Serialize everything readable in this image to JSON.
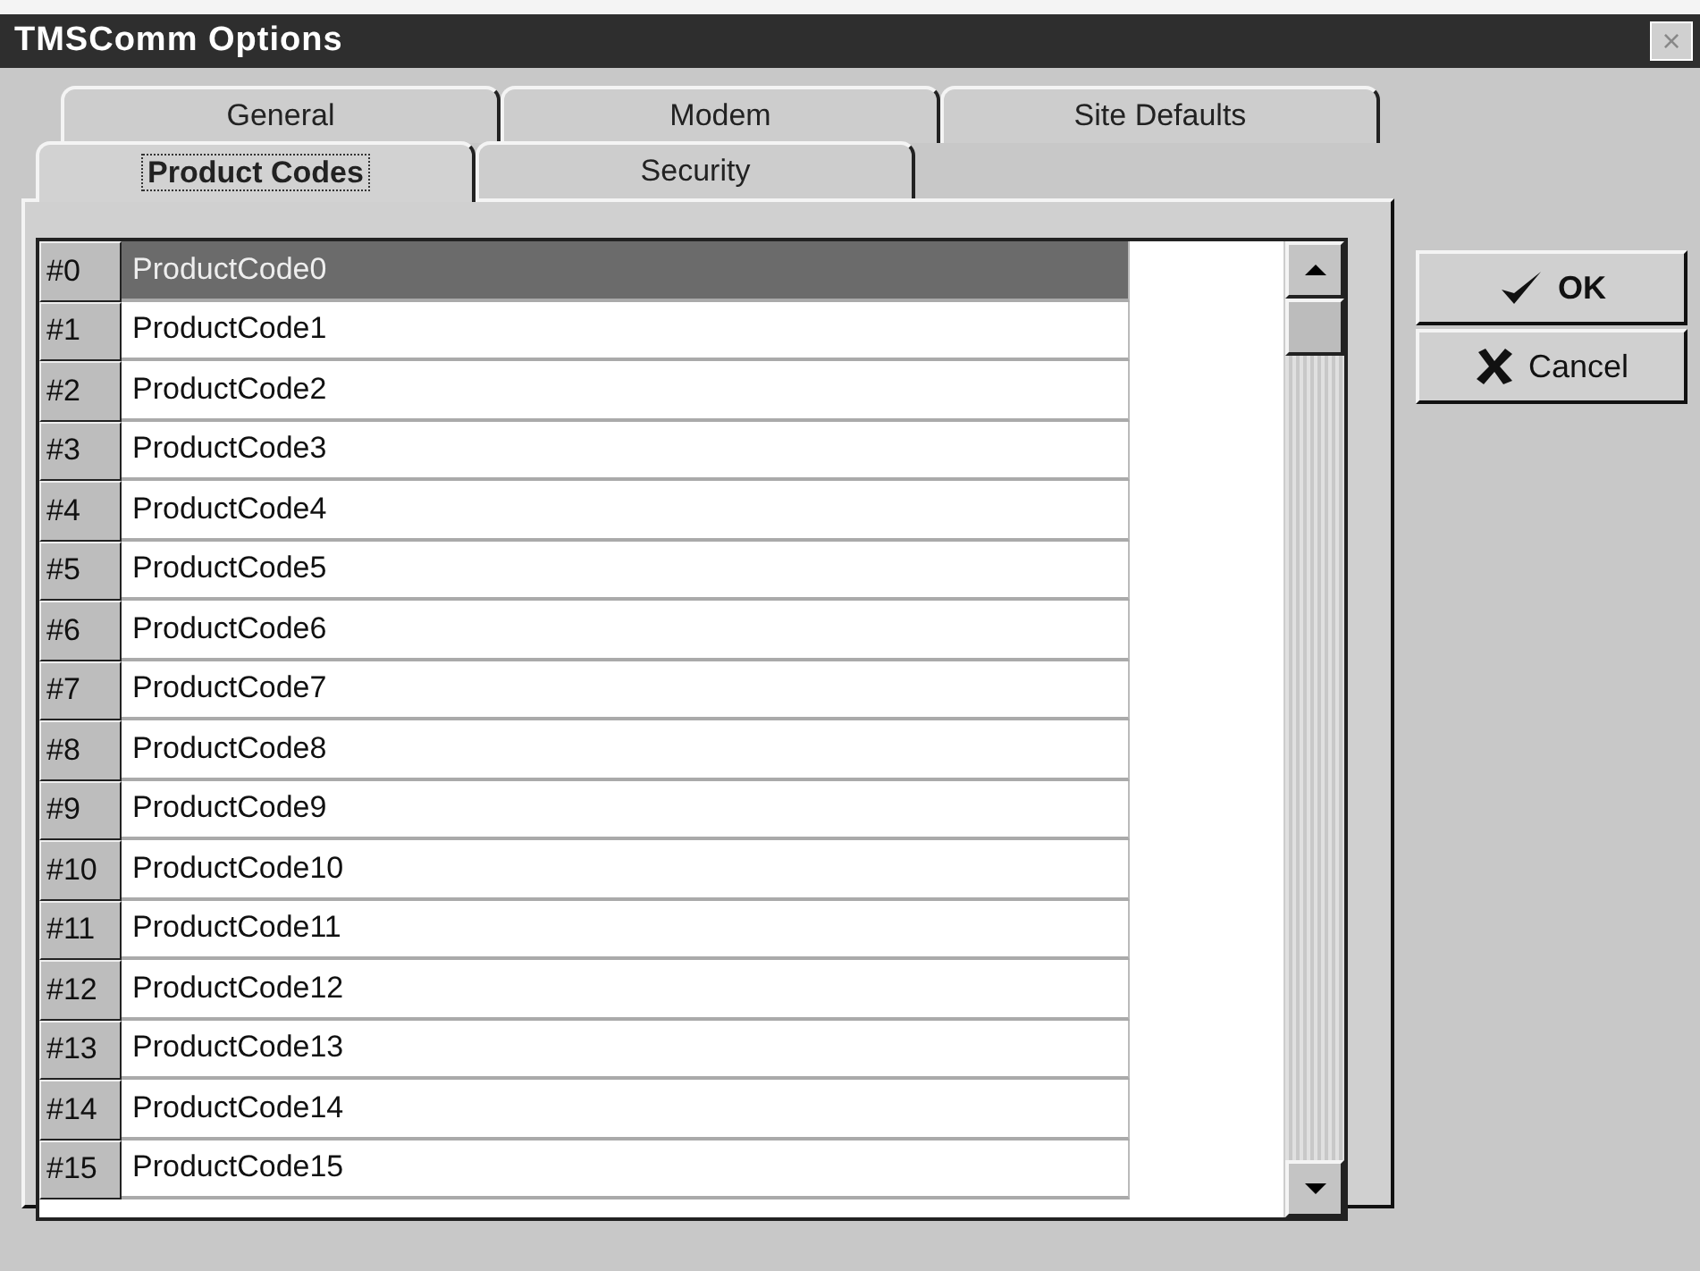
{
  "window": {
    "title": "TMSComm Options",
    "close": "×"
  },
  "tab_rows": [
    [
      {
        "label": "General",
        "selected": false
      },
      {
        "label": "Modem",
        "selected": false
      },
      {
        "label": "Site Defaults",
        "selected": false
      }
    ],
    [
      {
        "label": "Product Codes",
        "selected": true
      },
      {
        "label": "Security",
        "selected": false
      }
    ]
  ],
  "grid": {
    "rows": [
      {
        "header": "#0",
        "value": "ProductCode0",
        "selected": true
      },
      {
        "header": "#1",
        "value": "ProductCode1",
        "selected": false
      },
      {
        "header": "#2",
        "value": "ProductCode2",
        "selected": false
      },
      {
        "header": "#3",
        "value": "ProductCode3",
        "selected": false
      },
      {
        "header": "#4",
        "value": "ProductCode4",
        "selected": false
      },
      {
        "header": "#5",
        "value": "ProductCode5",
        "selected": false
      },
      {
        "header": "#6",
        "value": "ProductCode6",
        "selected": false
      },
      {
        "header": "#7",
        "value": "ProductCode7",
        "selected": false
      },
      {
        "header": "#8",
        "value": "ProductCode8",
        "selected": false
      },
      {
        "header": "#9",
        "value": "ProductCode9",
        "selected": false
      },
      {
        "header": "#10",
        "value": "ProductCode10",
        "selected": false
      },
      {
        "header": "#11",
        "value": "ProductCode11",
        "selected": false
      },
      {
        "header": "#12",
        "value": "ProductCode12",
        "selected": false
      },
      {
        "header": "#13",
        "value": "ProductCode13",
        "selected": false
      },
      {
        "header": "#14",
        "value": "ProductCode14",
        "selected": false
      },
      {
        "header": "#15",
        "value": "ProductCode15",
        "selected": false
      }
    ]
  },
  "buttons": [
    {
      "kind": "ok",
      "label": "OK"
    },
    {
      "kind": "cancel",
      "label": "Cancel"
    }
  ]
}
